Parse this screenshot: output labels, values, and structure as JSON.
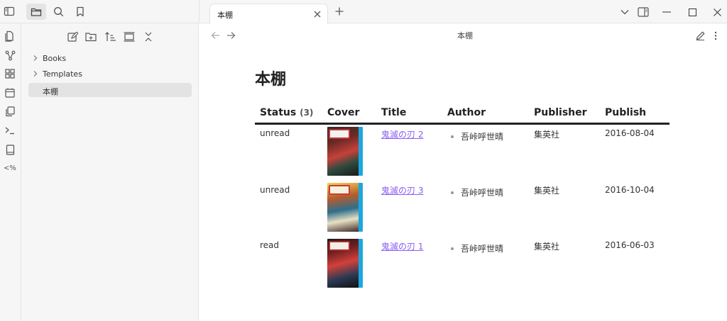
{
  "tab": {
    "label": "本棚"
  },
  "view_header": {
    "title": "本棚"
  },
  "explorer": {
    "tree": [
      {
        "label": "Books",
        "type": "folder"
      },
      {
        "label": "Templates",
        "type": "folder"
      },
      {
        "label": "本棚",
        "type": "file",
        "active": true
      }
    ]
  },
  "ribbon": {
    "percent_label": "<%"
  },
  "note": {
    "title": "本棚"
  },
  "table": {
    "headers": {
      "status": "Status",
      "status_count": "(3)",
      "cover": "Cover",
      "title": "Title",
      "author": "Author",
      "publisher": "Publisher",
      "publish": "Publish"
    },
    "rows": [
      {
        "status": "unread",
        "title": "鬼滅の刃 2",
        "author": "吾峠呼世晴",
        "publisher": "集英社",
        "publish": "2016-08-04",
        "cover": "book-cover-image"
      },
      {
        "status": "unread",
        "title": "鬼滅の刃 3",
        "author": "吾峠呼世晴",
        "publisher": "集英社",
        "publish": "2016-10-04",
        "cover": "book-cover-image"
      },
      {
        "status": "read",
        "title": "鬼滅の刃 1",
        "author": "吾峠呼世晴",
        "publisher": "集英社",
        "publish": "2016-06-03",
        "cover": "book-cover-image"
      }
    ]
  },
  "colors": {
    "accent_link": "#8a5cf5",
    "sidebar_bg": "#f6f6f6",
    "active_item_bg": "#e3e3e3"
  },
  "icons": [
    "sidebar-toggle-icon",
    "folder-icon",
    "search-icon",
    "bookmark-icon",
    "close-icon",
    "plus-icon",
    "chevron-down-icon",
    "right-sidebar-icon",
    "minimize-icon",
    "maximize-icon",
    "window-close-icon",
    "arrow-left-icon",
    "arrow-right-icon",
    "pencil-icon",
    "more-vertical-icon",
    "new-note-icon",
    "new-folder-icon",
    "sort-icon",
    "collapse-icon",
    "collapse-all-icon",
    "switcher-icon",
    "graph-icon",
    "canvas-icon",
    "calendar-icon",
    "copy-icon",
    "terminal-icon",
    "book-icon"
  ]
}
